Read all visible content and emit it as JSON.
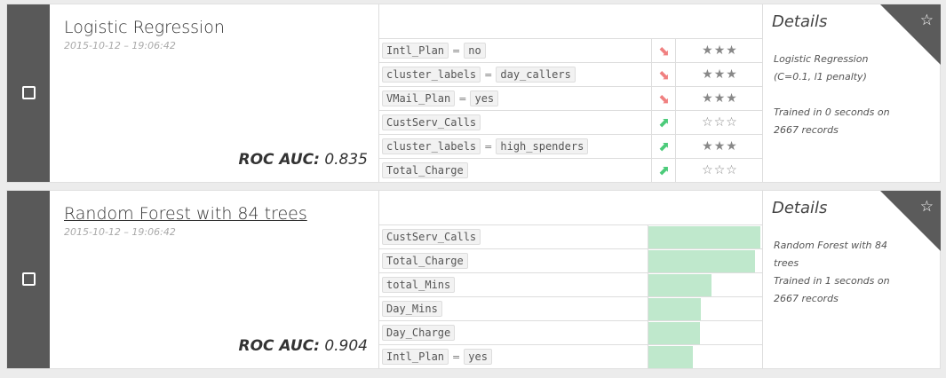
{
  "models": [
    {
      "title": "Logistic Regression",
      "timestamp": "2015-10-12 – 19:06:42",
      "metric_label": "ROC AUC:",
      "metric_value": "0.835",
      "features": [
        {
          "name": "Intl_Plan",
          "eq": "=",
          "value": "no",
          "direction": "down",
          "stars": "★★★"
        },
        {
          "name": "cluster_labels",
          "eq": "=",
          "value": "day_callers",
          "direction": "down",
          "stars": "★★★"
        },
        {
          "name": "VMail_Plan",
          "eq": "=",
          "value": "yes",
          "direction": "down",
          "stars": "★★★"
        },
        {
          "name": "CustServ_Calls",
          "eq": "",
          "value": "",
          "direction": "up",
          "stars": "☆☆☆"
        },
        {
          "name": "cluster_labels",
          "eq": "=",
          "value": "high_spenders",
          "direction": "up",
          "stars": "★★★"
        },
        {
          "name": "Total_Charge",
          "eq": "",
          "value": "",
          "direction": "up",
          "stars": "☆☆☆"
        }
      ],
      "details_title": "Details",
      "details_desc": "Logistic Regression (C=0.1, l1 penalty)",
      "details_trained": "Trained in 0 seconds on 2667 records"
    },
    {
      "title": "Random Forest with 84 trees",
      "timestamp": "2015-10-12 – 19:06:42",
      "metric_label": "ROC AUC:",
      "metric_value": "0.904",
      "features": [
        {
          "name": "CustServ_Calls",
          "eq": "",
          "value": "",
          "importance": 1.0
        },
        {
          "name": "Total_Charge",
          "eq": "",
          "value": "",
          "importance": 0.95
        },
        {
          "name": "total_Mins",
          "eq": "",
          "value": "",
          "importance": 0.56
        },
        {
          "name": "Day_Mins",
          "eq": "",
          "value": "",
          "importance": 0.47
        },
        {
          "name": "Day_Charge",
          "eq": "",
          "value": "",
          "importance": 0.46
        },
        {
          "name": "Intl_Plan",
          "eq": "=",
          "value": "yes",
          "importance": 0.4
        }
      ],
      "details_title": "Details",
      "details_desc": "Random Forest with 84 trees",
      "details_trained": "Trained in 1 seconds on 2667 records"
    }
  ],
  "icons": {
    "checkbox": "checkbox-icon",
    "favorite": "star-outline-icon",
    "up": "arrow-up-right-icon",
    "down": "arrow-down-right-icon"
  },
  "colors": {
    "sidebar": "#595959",
    "bar": "#bfe8cc",
    "up_arrow": "#4ccb7a",
    "down_arrow": "#f08080"
  }
}
